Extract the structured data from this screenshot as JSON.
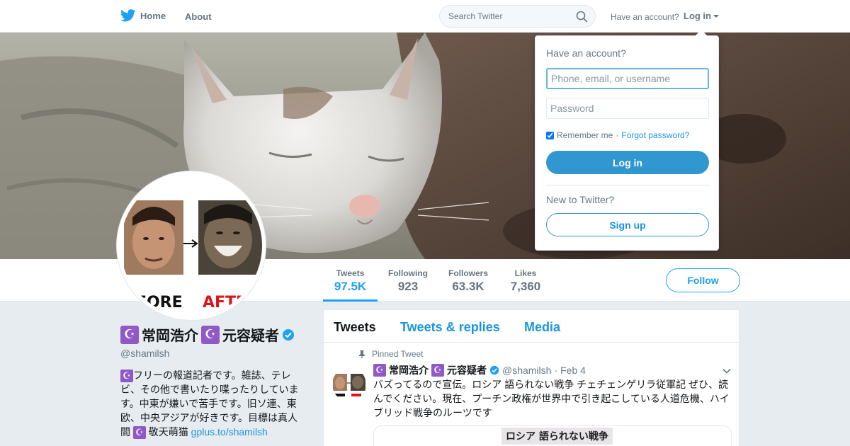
{
  "nav": {
    "home_label": "Home",
    "about_label": "About",
    "search_placeholder": "Search Twitter",
    "have_account": "Have an account?",
    "login_label": "Log in"
  },
  "profile": {
    "name": "常岡浩介",
    "name_suffix": "元容疑者",
    "crescent_glyph": "☪",
    "handle": "@shamilsh",
    "avatar_text_left": "FORE",
    "avatar_text_right": "AFTE",
    "bio_line": "フリーの報道記者です。雑誌、テレビ、その他で書いたり喋ったりしています。中東が嫌いで苦手です。旧ソ連、東欧、中央アジアが好きです。目標は真人間",
    "bio_tail": "敬天萌猫",
    "bio_link": "gplus.to/shamilsh",
    "follow_label": "Follow"
  },
  "stats": [
    {
      "label": "Tweets",
      "value": "97.5K"
    },
    {
      "label": "Following",
      "value": "923"
    },
    {
      "label": "Followers",
      "value": "63.3K"
    },
    {
      "label": "Likes",
      "value": "7,360"
    }
  ],
  "timeline": {
    "tabs": [
      "Tweets",
      "Tweets & replies",
      "Media"
    ],
    "pinned_label": "Pinned Tweet",
    "tweet": {
      "name": "常岡浩介",
      "name_suffix": "元容疑者",
      "handle": "@shamilsh",
      "dot": "·",
      "time": "Feb 4",
      "text": "バズってるので宣伝。ロシア 語られない戦争 チェチェンゲリラ従軍記 ぜひ、読んでください。現在、プーチン政権が世界中で引き起こしている人道危機、ハイブリッド戦争のルーツです",
      "card_title": "ロシア 語られない戦争"
    }
  },
  "login": {
    "title": "Have an account?",
    "username_placeholder": "Phone, email, or username",
    "password_placeholder": "Password",
    "remember_label": "Remember me",
    "separator": "·",
    "forgot_label": "Forgot password?",
    "login_button": "Log in",
    "new_label": "New to Twitter?",
    "signup_button": "Sign up"
  },
  "colors": {
    "accent": "#1da1f2",
    "link": "#1b95e0",
    "crescent_bg": "#9059c8",
    "login_button": "#3097d1"
  }
}
